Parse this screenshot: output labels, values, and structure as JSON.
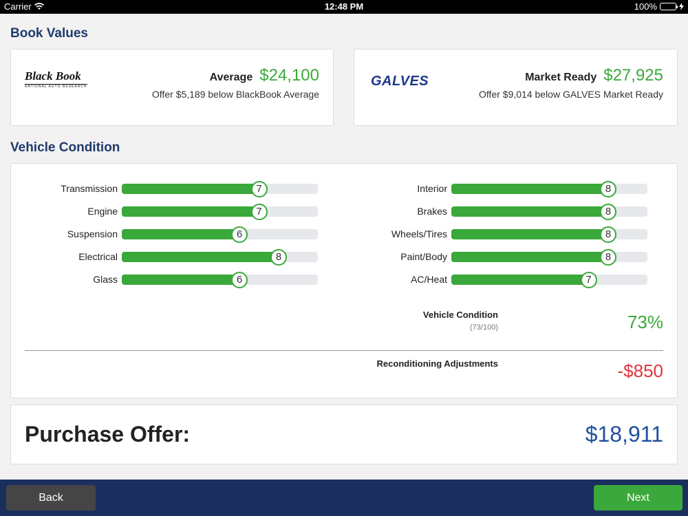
{
  "status_bar": {
    "carrier": "Carrier",
    "time": "12:48 PM",
    "battery": "100%"
  },
  "book_values": {
    "title": "Book Values",
    "cards": [
      {
        "logo_text": "Black Book",
        "logo_tag": "NATIONAL AUTO RESEARCH",
        "label": "Average",
        "value": "$24,100",
        "sub": "Offer $5,189 below BlackBook Average"
      },
      {
        "logo_text": "GALVES",
        "label": "Market Ready",
        "value": "$27,925",
        "sub": "Offer $9,014 below GALVES Market Ready"
      }
    ]
  },
  "vehicle_condition": {
    "title": "Vehicle Condition",
    "max_rating": 10,
    "left": [
      {
        "label": "Transmission",
        "value": 7
      },
      {
        "label": "Engine",
        "value": 7
      },
      {
        "label": "Suspension",
        "value": 6
      },
      {
        "label": "Electrical",
        "value": 8
      },
      {
        "label": "Glass",
        "value": 6
      }
    ],
    "right": [
      {
        "label": "Interior",
        "value": 8
      },
      {
        "label": "Brakes",
        "value": 8
      },
      {
        "label": "Wheels/Tires",
        "value": 8
      },
      {
        "label": "Paint/Body",
        "value": 8
      },
      {
        "label": "AC/Heat",
        "value": 7
      }
    ],
    "summary_label": "Vehicle Condition",
    "summary_sub": "(73/100)",
    "summary_value": "73%",
    "recon_label": "Reconditioning Adjustments",
    "recon_value": "-$850"
  },
  "purchase_offer": {
    "label": "Purchase Offer:",
    "value": "$18,911"
  },
  "buttons": {
    "back": "Back",
    "next": "Next"
  },
  "colors": {
    "accent_green": "#3aa83a",
    "title_blue": "#1f3a6b",
    "offer_blue": "#1f4f9e",
    "negative_red": "#e0353f",
    "bottom_bar": "#1b2f5e"
  }
}
